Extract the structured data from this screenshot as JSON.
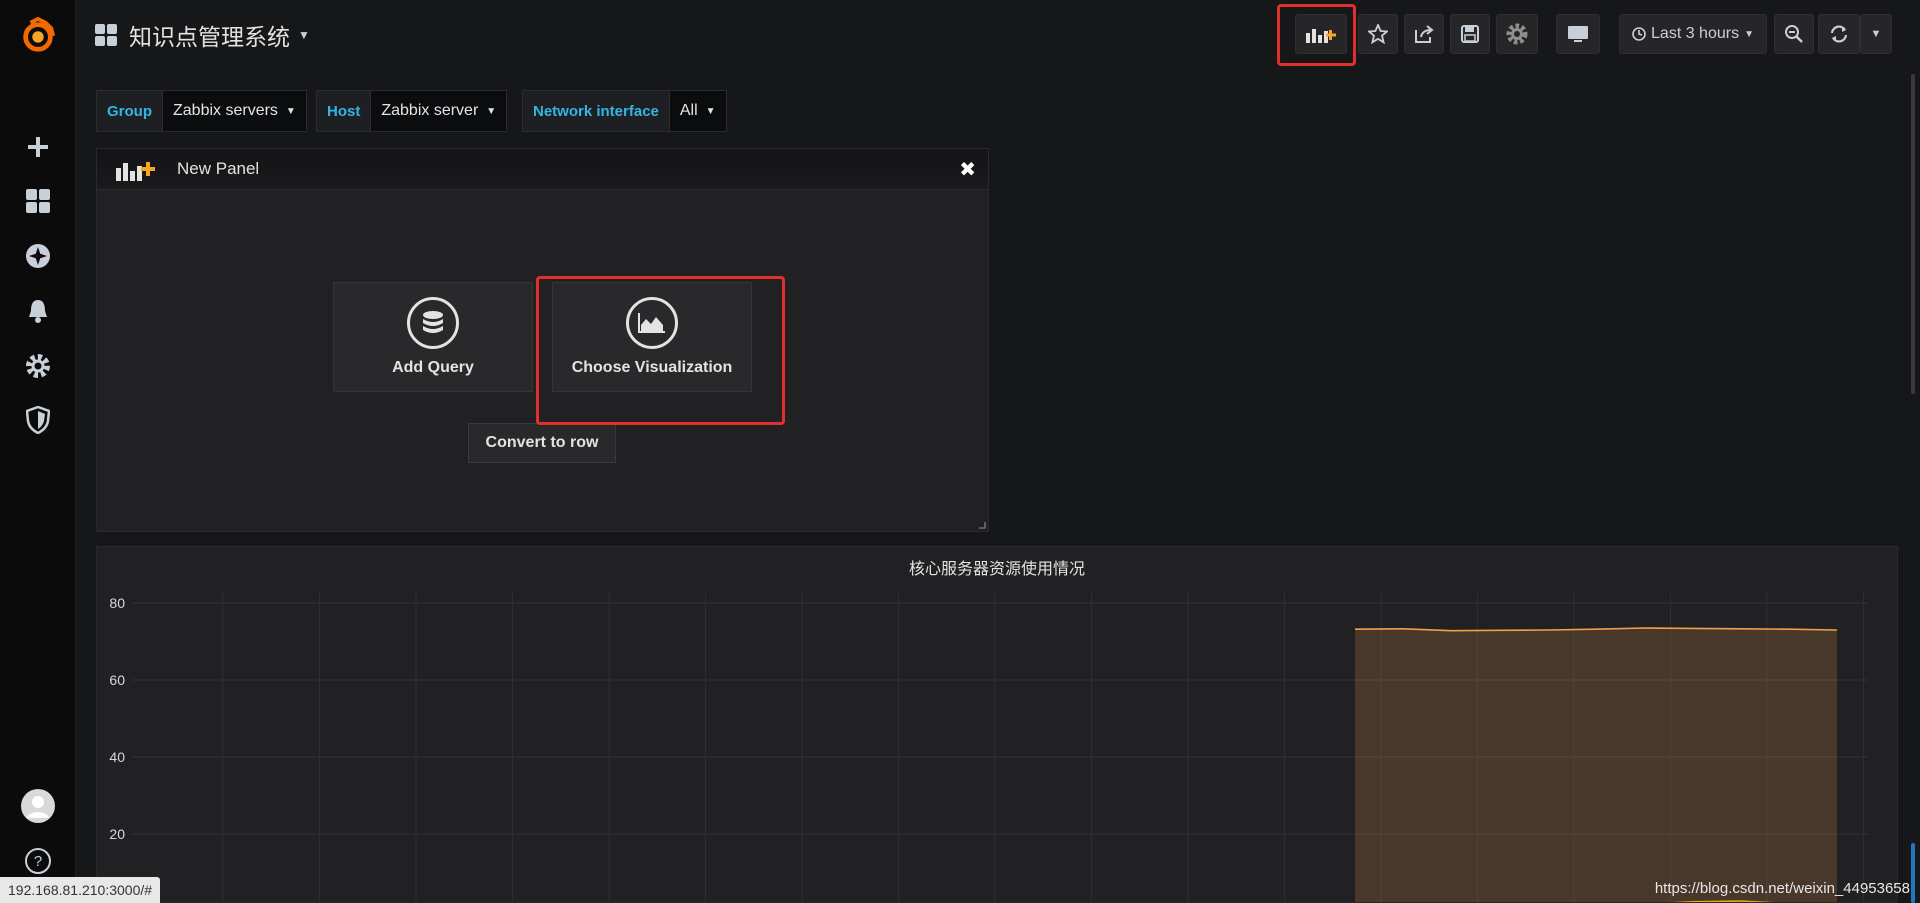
{
  "dashboard": {
    "title": "知识点管理系统"
  },
  "toolbar": {
    "time_range_label": "Last 3 hours"
  },
  "variables": [
    {
      "label": "Group",
      "value": "Zabbix servers"
    },
    {
      "label": "Host",
      "value": "Zabbix server"
    },
    {
      "label": "Network interface",
      "value": "All"
    }
  ],
  "new_panel": {
    "title": "New Panel",
    "add_query_label": "Add Query",
    "choose_visualization_label": "Choose Visualization",
    "convert_label": "Convert to row"
  },
  "graph_panel": {
    "title": "核心服务器资源使用情况"
  },
  "chart_data": {
    "type": "line",
    "title": "核心服务器资源使用情况",
    "ylim": [
      0,
      80
    ],
    "y_ticks": [
      "80",
      "60",
      "40",
      "20"
    ],
    "grid": true,
    "series": [
      {
        "values": [
          73.2,
          73.3,
          72.8,
          72.9,
          73.0,
          73.2,
          73.5,
          73.4,
          73.3,
          73.2,
          73.0
        ],
        "color": "#f29f4a"
      },
      {
        "values": [
          0.8,
          1.5,
          1.6,
          1.9,
          1.7,
          2.1,
          1.8,
          2.4,
          2.6,
          1.9,
          1.2
        ],
        "color": "#e5ac0e"
      },
      {
        "values": [
          0.3,
          0.5,
          0.6,
          0.4,
          0.7,
          0.6,
          0.5,
          0.9,
          0.8,
          0.6,
          0.4
        ],
        "color": "#7eb26d"
      }
    ]
  },
  "status_bar": {
    "url": "192.168.81.210:3000/#"
  },
  "watermark": "https://blog.csdn.net/weixin_44953658",
  "colors": {
    "accent": "#33b5e5",
    "highlight": "#e02f2f",
    "brand": "#f46800"
  }
}
